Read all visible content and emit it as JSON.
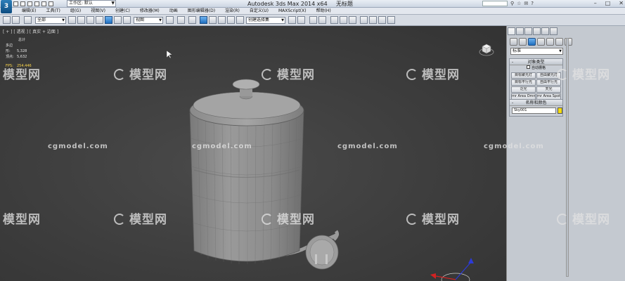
{
  "window": {
    "app_icon": "3ds-max-logo-icon",
    "workspace": "工作区: 默认",
    "title": "Autodesk 3ds Max  2014 x64",
    "file_name": "无标题"
  },
  "menu": {
    "items": [
      "编辑(E)",
      "工具(T)",
      "组(G)",
      "视图(V)",
      "创建(C)",
      "修改器(M)",
      "动画",
      "图形编辑器(D)",
      "渲染(R)",
      "自定义(U)",
      "MAXScript(X)",
      "帮助(H)"
    ]
  },
  "toolbar": {
    "selection_filter": "全部",
    "ref_coord": "视图",
    "named_selection": "创建选择集"
  },
  "viewport": {
    "label": "[ + ] [ 透视 ] [ 真实 + 边面 ]",
    "stats": {
      "header": "总计",
      "polys_label": "多边形:",
      "polys_value": "5,328",
      "verts_label": "顶点:",
      "verts_value": "5,632",
      "fps_label": "FPS:",
      "fps_value": "254.446"
    },
    "colors": {
      "background": "#3d3d3d",
      "mesh": "#8a8a8a",
      "wire": "#5e5e5e"
    }
  },
  "watermark": {
    "logo_text": "模型网",
    "url": "cgmodel.com"
  },
  "command_panel": {
    "tab_icons": [
      "create-icon",
      "modify-icon",
      "hierarchy-icon",
      "motion-icon",
      "display-icon",
      "utilities-icon"
    ],
    "sub_icons": [
      "geometry-icon",
      "shapes-icon",
      "lights-icon",
      "cameras-icon",
      "helpers-icon",
      "spacewarps-icon",
      "systems-icon"
    ],
    "category": "标准",
    "object_type": {
      "title": "对象类型",
      "autogrid": "自动栅格",
      "buttons": [
        "目标聚光灯",
        "自由聚光灯",
        "目标平行光",
        "自由平行光",
        "泛光",
        "天光",
        "mr Area Omni",
        "mr Area Spot"
      ]
    },
    "name_color": {
      "title": "名称和颜色",
      "name": "Sky001",
      "color": "#f5dc0a"
    }
  }
}
